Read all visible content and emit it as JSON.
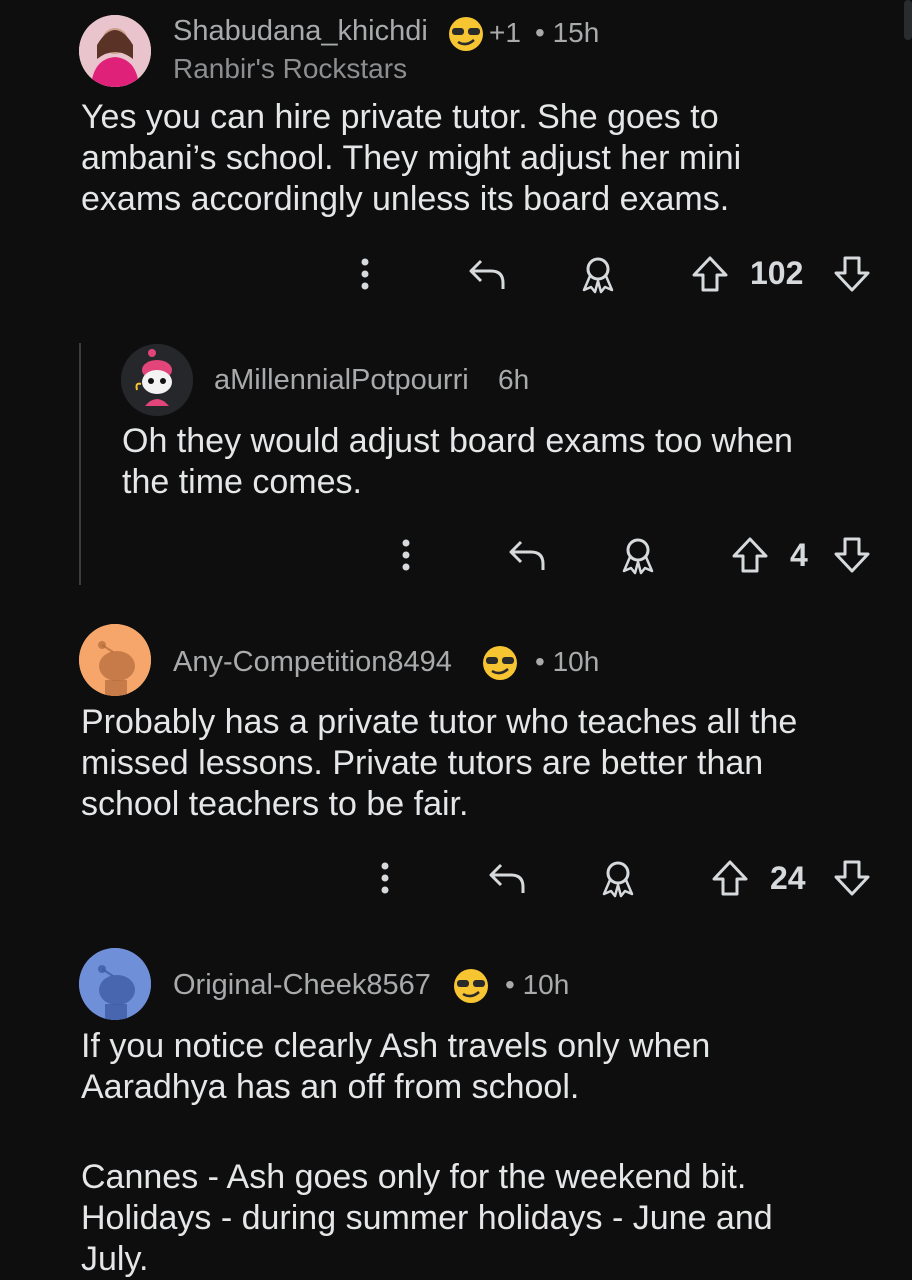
{
  "comments": [
    {
      "username": "Shabudana_khichdi",
      "award": "+1",
      "time": "• 15h",
      "flair": "Ranbir's Rockstars",
      "body": [
        "Yes you can hire private tutor. She goes to",
        "ambani’s school. They might adjust her mini",
        "exams accordingly unless its board exams."
      ],
      "votes": "102"
    },
    {
      "username": "aMillennialPotpourri",
      "time": "6h",
      "body": [
        "Oh they would adjust board exams too when",
        "the time comes."
      ],
      "votes": "4"
    },
    {
      "username": "Any-Competition8494",
      "time": "• 10h",
      "body": [
        "Probably has a private tutor who teaches all the",
        "missed lessons. Private tutors are better than",
        "school teachers to be fair."
      ],
      "votes": "24"
    },
    {
      "username": "Original-Cheek8567",
      "time": "• 10h",
      "body": [
        "If you notice clearly Ash travels only when",
        "Aaradhya has an off from school.",
        "",
        "Cannes - Ash goes only for the weekend bit.",
        "Holidays - during summer holidays - June and",
        "July."
      ]
    }
  ],
  "icons": {
    "more": "more-options-icon",
    "reply": "reply-icon",
    "award": "award-icon",
    "upvote": "upvote-arrow-icon",
    "downvote": "downvote-arrow-icon",
    "badge": "sunglasses-emoji-badge-icon"
  },
  "colors": {
    "background": "#0e0e0f",
    "text": "#e4e6e7",
    "meta": "#a8aaab",
    "avatar_orange": "#f6a66a",
    "avatar_blue": "#6f8fd8"
  }
}
